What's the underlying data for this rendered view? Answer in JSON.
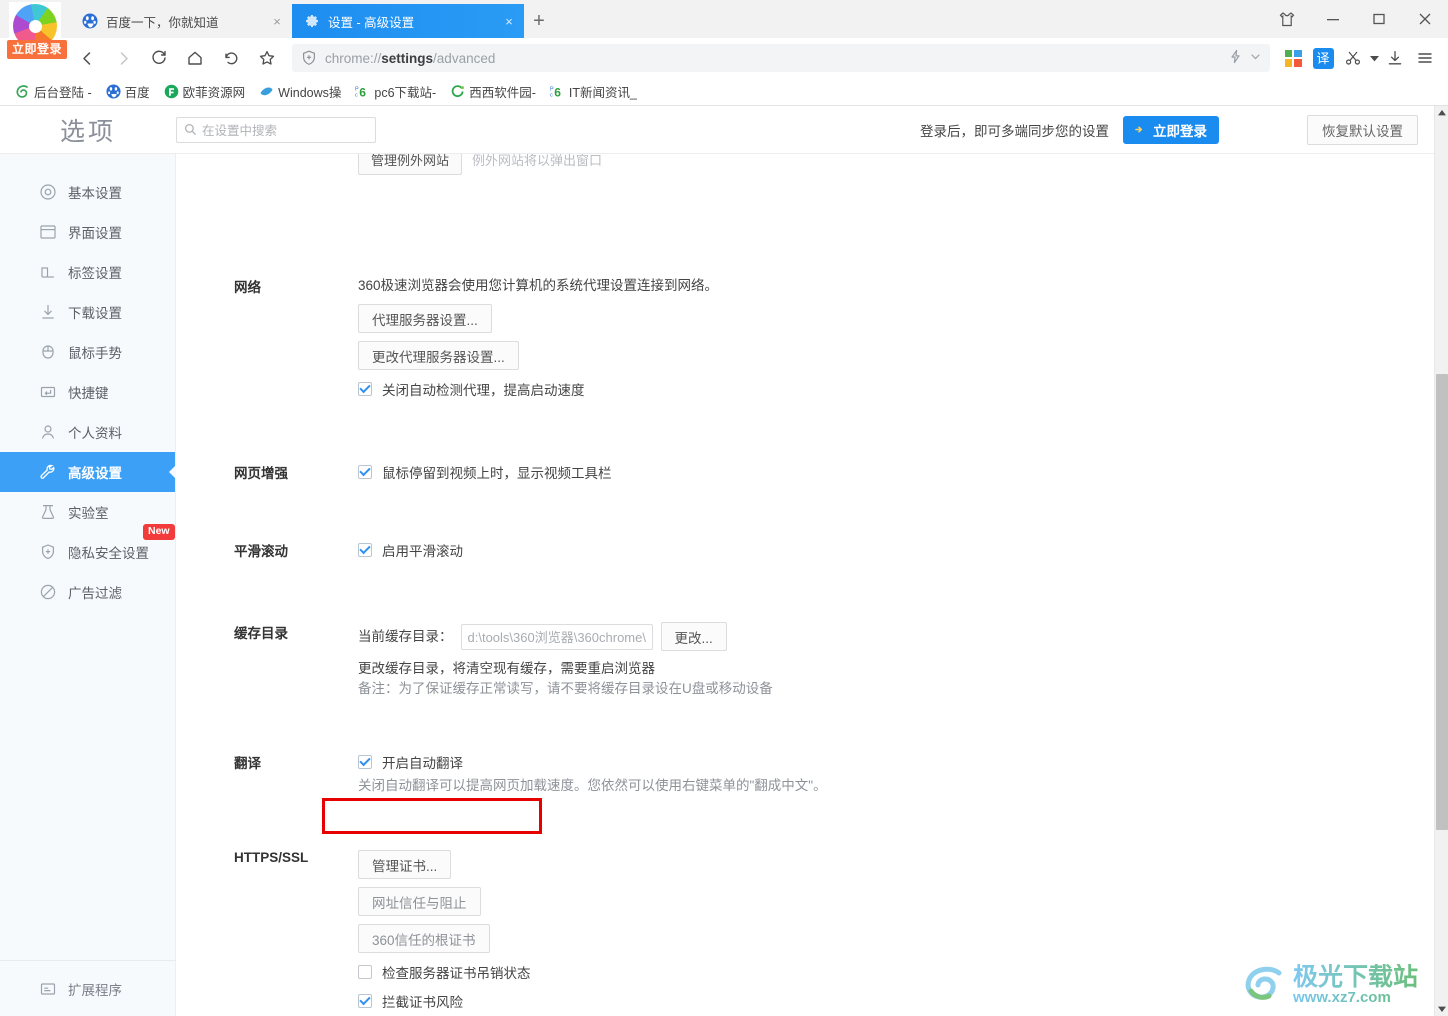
{
  "window": {
    "controls": [
      "clothes-icon",
      "minimize",
      "maximize",
      "close"
    ]
  },
  "tabs": [
    {
      "title": "百度一下，你就知道",
      "favicon": "baidu-icon",
      "active": false,
      "close_label": "×"
    },
    {
      "title": "设置 - 高级设置",
      "favicon": "gear-icon",
      "active": true,
      "close_label": "×"
    }
  ],
  "newtab_label": "+",
  "toolbar": {
    "back_label": "‹",
    "forward_label": "›",
    "url_prefix": "chrome://",
    "url_bold": "settings",
    "url_suffix": "/advanced",
    "translate_label": "译"
  },
  "bookmarks": [
    {
      "label": "后台登陆 -",
      "icon": "swirl-icon",
      "color": "#3aa65a"
    },
    {
      "label": "百度",
      "icon": "baidu-icon",
      "color": "#2b6fd6"
    },
    {
      "label": "欧菲资源网",
      "icon": "circle-icon",
      "color": "#1aa85a"
    },
    {
      "label": "Windows操",
      "icon": "win-icon",
      "color": "#3aa0dd"
    },
    {
      "label": "pc6下载站-",
      "icon": "pc6-icon",
      "color": "#2c9f3c"
    },
    {
      "label": "西西软件园-",
      "icon": "cc-icon",
      "color": "#2aa84a"
    },
    {
      "label": "IT新闻资讯_",
      "icon": "pc6-icon",
      "color": "#2c9f3c"
    }
  ],
  "settings": {
    "title": "选项",
    "search_placeholder": "在设置中搜索",
    "sync_text": "登录后，即可多端同步您的设置",
    "login_button": "立即登录",
    "reset_button": "恢复默认设置",
    "login_badge": "立即登录"
  },
  "sidebar": {
    "items": [
      {
        "label": "基本设置",
        "icon": "target-icon",
        "active": false,
        "badge": null
      },
      {
        "label": "界面设置",
        "icon": "window-icon",
        "active": false,
        "badge": null
      },
      {
        "label": "标签设置",
        "icon": "tab-icon",
        "active": false,
        "badge": null
      },
      {
        "label": "下载设置",
        "icon": "download-icon",
        "active": false,
        "badge": null
      },
      {
        "label": "鼠标手势",
        "icon": "mouse-icon",
        "active": false,
        "badge": null
      },
      {
        "label": "快捷键",
        "icon": "keyboard-icon",
        "active": false,
        "badge": null
      },
      {
        "label": "个人资料",
        "icon": "user-icon",
        "active": false,
        "badge": null
      },
      {
        "label": "高级设置",
        "icon": "wrench-icon",
        "active": true,
        "badge": null
      },
      {
        "label": "实验室",
        "icon": "flask-icon",
        "active": false,
        "badge": null
      },
      {
        "label": "隐私安全设置",
        "icon": "shield-plus-icon",
        "active": false,
        "badge": "New"
      },
      {
        "label": "广告过滤",
        "icon": "block-icon",
        "active": false,
        "badge": null
      }
    ],
    "bottom": {
      "label": "扩展程序",
      "icon": "extension-icon"
    }
  },
  "content": {
    "cutoff_row": {
      "button": "管理例外网站",
      "text": "例外网站将以弹出窗口"
    },
    "sections": [
      {
        "key": "network",
        "label": "网络",
        "desc": "360极速浏览器会使用您计算机的系统代理设置连接到网络。",
        "buttons": [
          "代理服务器设置...",
          "更改代理服务器设置..."
        ],
        "checkbox": {
          "label": "关闭自动检测代理，提高启动速度",
          "checked": true
        }
      },
      {
        "key": "web-enhance",
        "label": "网页增强",
        "checkbox": {
          "label": "鼠标停留到视频上时，显示视频工具栏",
          "checked": true
        }
      },
      {
        "key": "smooth-scroll",
        "label": "平滑滚动",
        "checkbox": {
          "label": "启用平滑滚动",
          "checked": true
        }
      },
      {
        "key": "cache-dir",
        "label": "缓存目录",
        "field_label": "当前缓存目录：",
        "field_value": "d:\\tools\\360浏览器\\360chrome\\",
        "change_button": "更改...",
        "note1": "更改缓存目录，将清空现有缓存，需要重启浏览器",
        "note2": "备注：为了保证缓存正常读写，请不要将缓存目录设在U盘或移动设备"
      },
      {
        "key": "translate",
        "label": "翻译",
        "checkbox": {
          "label": "开启自动翻译",
          "checked": true
        },
        "note": "关闭自动翻译可以提高网页加载速度。您依然可以使用右键菜单的\"翻成中文\"。",
        "highlighted": true,
        "highlight_color": "#e60000"
      },
      {
        "key": "https-ssl",
        "label": "HTTPS/SSL",
        "buttons": [
          "管理证书...",
          "网址信任与阻止",
          "360信任的根证书"
        ],
        "checkboxes": [
          {
            "label": "检查服务器证书吊销状态",
            "checked": false
          },
          {
            "label": "拦截证书风险",
            "checked": true
          }
        ]
      }
    ]
  },
  "watermark": {
    "main": "极光下载站",
    "sub": "www.xz7.com"
  }
}
